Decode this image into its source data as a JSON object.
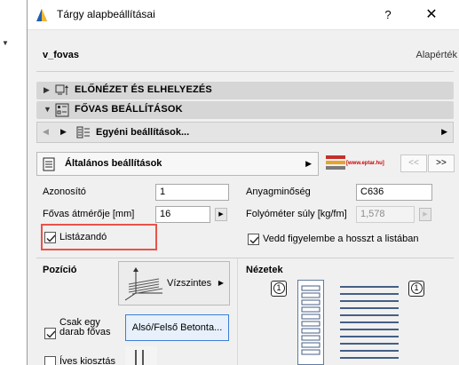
{
  "window": {
    "title": "Tárgy alapbeállításai",
    "help_label": "?",
    "close_label": "✕"
  },
  "object": {
    "name": "v_fovas",
    "default_label": "Alapérték"
  },
  "sections": {
    "preview": {
      "label": "ELŐNÉZET ÉS ELHELYEZÉS",
      "state": "collapsed"
    },
    "settings": {
      "label": "FŐVAS BEÁLLÍTÁSOK",
      "state": "expanded"
    }
  },
  "nav": {
    "label": "Egyéni beállítások..."
  },
  "panel": {
    "label": "Általános beállítások",
    "logo_text": "[www.eptar.hu]",
    "prev_label": "<<",
    "next_label": ">>"
  },
  "form": {
    "azonosito_label": "Azonosító",
    "azonosito_value": "1",
    "atmero_label": "Fővas átmérője [mm]",
    "atmero_value": "16",
    "anyagminoseg_label": "Anyagminőség",
    "anyagminoseg_value": "C636",
    "folyometer_label": "Folyóméter súly [kg/fm]",
    "folyometer_value": "1,578",
    "listazando_label": "Listázandó",
    "listazando_checked": true,
    "hossz_label": "Vedd figyelembe a hosszt a listában",
    "hossz_checked": true
  },
  "position": {
    "label": "Pozíció",
    "value": "Vízszintes",
    "csak_egy_label_1": "Csak egy",
    "csak_egy_label_2": "darab fővas",
    "csak_egy_checked": true,
    "betonta_label": "Alsó/Felső Betonta...",
    "ives_label": "Íves kiosztás",
    "ives_checked": false
  },
  "views": {
    "label": "Nézetek",
    "left_num": "1",
    "right_num": "1"
  },
  "colors": {
    "highlight": "#e8534a",
    "accent": "#3d7fd3"
  }
}
